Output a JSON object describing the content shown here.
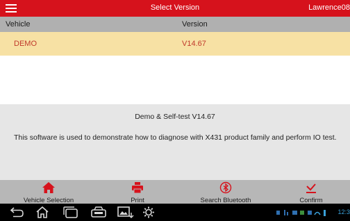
{
  "header": {
    "title": "Select Version",
    "user": "Lawrence08"
  },
  "table": {
    "columns": [
      "Vehicle",
      "Version"
    ],
    "rows": [
      {
        "vehicle": "DEMO",
        "version": "V14.67"
      }
    ]
  },
  "description": {
    "title": "Demo & Self-test V14.67",
    "text": "This software is used to demonstrate how to diagnose with X431 product family and perform IO test."
  },
  "toolbar": {
    "vehicle_selection": "Vehicle Selection",
    "print": "Print",
    "search_bluetooth": "Search Bluetooth",
    "confirm": "Confirm"
  },
  "status": {
    "time": "12:3"
  },
  "colors": {
    "brand_red": "#d6121c",
    "selected_row": "#f7e1a4"
  }
}
